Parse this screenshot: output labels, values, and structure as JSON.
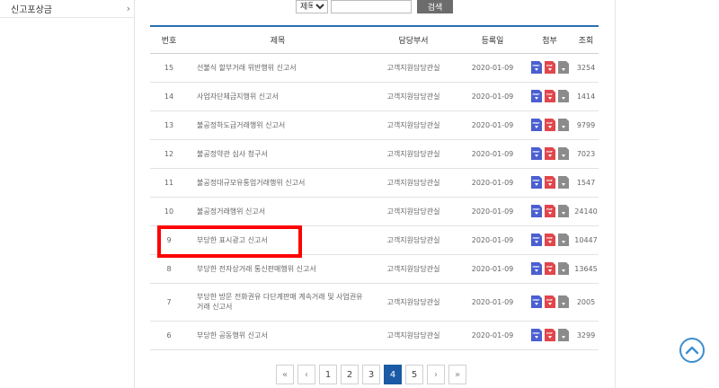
{
  "sidebar": {
    "items": [
      {
        "label": "신고포상금",
        "chevron": "›"
      }
    ]
  },
  "search": {
    "field_option": "제목",
    "query": "",
    "button": "검색"
  },
  "table": {
    "columns": [
      "번호",
      "제목",
      "담당부서",
      "등록일",
      "첨부",
      "조회"
    ],
    "rows": [
      {
        "no": "15",
        "title": "선불식 할부거래 위반행위 신고서",
        "dept": "고객지원담당관실",
        "date": "2020-01-09",
        "views": "3254"
      },
      {
        "no": "14",
        "title": "사업자단체금지행위 신고서",
        "dept": "고객지원담당관실",
        "date": "2020-01-09",
        "views": "1414"
      },
      {
        "no": "13",
        "title": "불공정하도급거래행위 신고서",
        "dept": "고객지원담당관실",
        "date": "2020-01-09",
        "views": "9799"
      },
      {
        "no": "12",
        "title": "불공정약관 심사 청구서",
        "dept": "고객지원담당관실",
        "date": "2020-01-09",
        "views": "7023"
      },
      {
        "no": "11",
        "title": "불공정대규모유통업거래행위 신고서",
        "dept": "고객지원담당관실",
        "date": "2020-01-09",
        "views": "1547"
      },
      {
        "no": "10",
        "title": "불공정거래행위 신고서",
        "dept": "고객지원담당관실",
        "date": "2020-01-09",
        "views": "24140"
      },
      {
        "no": "9",
        "title": "부당한 표시광고 신고서",
        "dept": "고객지원담당관실",
        "date": "2020-01-09",
        "views": "10447"
      },
      {
        "no": "8",
        "title": "부당한 전자상거래 통신판매행위 신고서",
        "dept": "고객지원담당관실",
        "date": "2020-01-09",
        "views": "13645"
      },
      {
        "no": "7",
        "title": "부당한 방문 전화권유 다단계판매 계속거래 및 사업권유거래 신고서",
        "dept": "고객지원담당관실",
        "date": "2020-01-09",
        "views": "2005"
      },
      {
        "no": "6",
        "title": "부당한 공동행위 신고서",
        "dept": "고객지원담당관실",
        "date": "2020-01-09",
        "views": "3299"
      }
    ],
    "attachment_icons": [
      {
        "name": "hwp-file-icon",
        "text": "HWP",
        "color": "#4b5fd0"
      },
      {
        "name": "pdf-file-icon",
        "text": "PDF",
        "color": "#e0464b"
      },
      {
        "name": "download-file-icon",
        "text": "",
        "color": "#8b8b8b"
      }
    ]
  },
  "pager": {
    "first": "«",
    "prev": "‹",
    "pages": [
      "1",
      "2",
      "3",
      "4",
      "5"
    ],
    "active": "4",
    "next": "›",
    "last": "»"
  },
  "top_button": {
    "icon": "chevron-up-icon",
    "color": "#3c8fd0"
  },
  "highlight": {
    "row": "9",
    "color": "#ff0000"
  }
}
